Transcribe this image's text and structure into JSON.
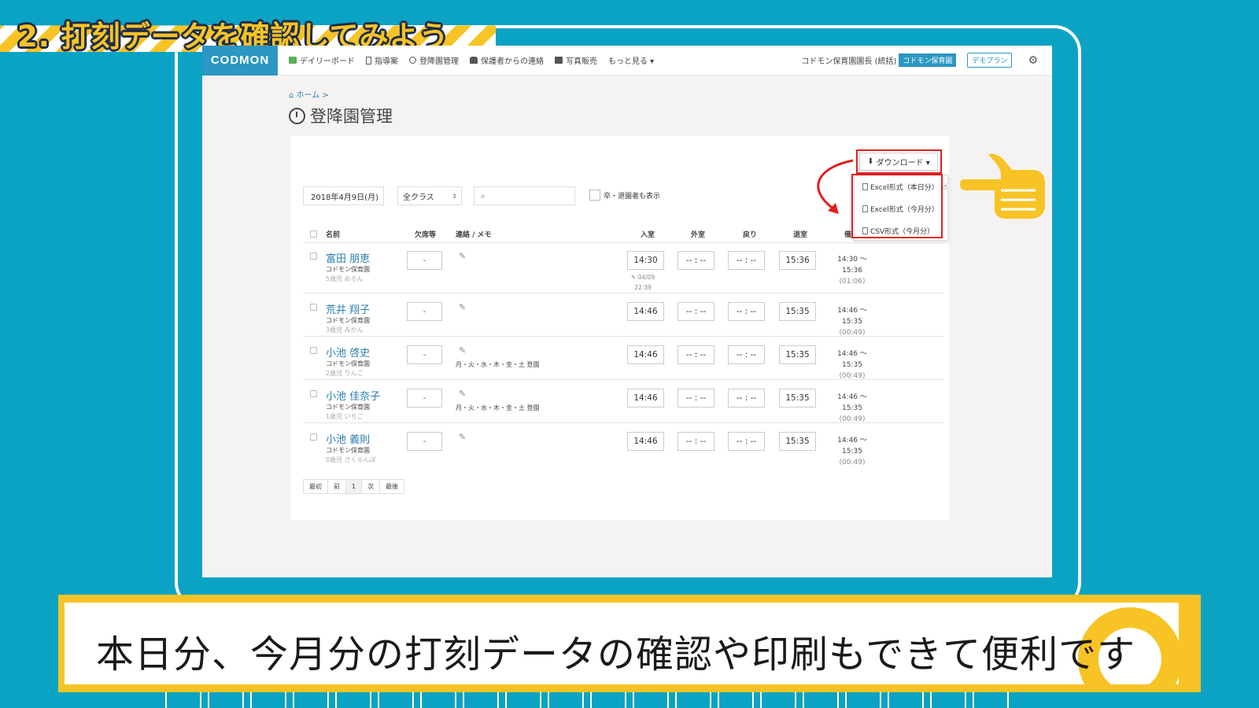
{
  "banner": {
    "title": "2. 打刻データを確認してみよう"
  },
  "nav": {
    "logo": "CODMON",
    "items": [
      "デイリーボード",
      "指導案",
      "登降園管理",
      "保護者からの連絡",
      "写真販売",
      "もっと見る ▾"
    ],
    "user": "コドモン保育園園長 (統括)",
    "org_badge": "コドモン保育園",
    "demo_plan": "デモプラン"
  },
  "page": {
    "breadcrumb": "ホーム >",
    "title": "登降園管理"
  },
  "toolbar": {
    "download_label": "ダウンロード ▾",
    "download_options": [
      "Excel形式（本日分）",
      "Excel形式（今月分）",
      "CSV形式（今月分）"
    ],
    "date": "2018年4月9日(月)",
    "class_select": "全クラス",
    "show_graduates": "卒・退園者も表示"
  },
  "table": {
    "headers": {
      "name": "名前",
      "absence": "欠席等",
      "memo": "連絡 / メモ",
      "in": "入室",
      "out": "外室",
      "back": "戻り",
      "leave": "退室",
      "note": "備"
    },
    "rows": [
      {
        "name": "富田 朋恵",
        "org": "コドモン保育園",
        "cls": "5歳児 めろん",
        "absence": "-",
        "memo": "",
        "in": "14:30",
        "out": "-- : --",
        "back": "-- : --",
        "leave": "15:36",
        "edit_date": "04/09",
        "edit_time": "22:39",
        "dur_from": "14:30 〜",
        "dur_to": "15:36",
        "dur": "(01:06)"
      },
      {
        "name": "荒井 翔子",
        "org": "コドモン保育園",
        "cls": "3歳児 みかん",
        "absence": "-",
        "memo": "",
        "in": "14:46",
        "out": "-- : --",
        "back": "-- : --",
        "leave": "15:35",
        "dur_from": "14:46 〜",
        "dur_to": "15:35",
        "dur": "(00:49)"
      },
      {
        "name": "小池 啓史",
        "org": "コドモン保育園",
        "cls": "2歳児 りんご",
        "absence": "-",
        "memo": "月・火・水・木・金・土 登園",
        "in": "14:46",
        "out": "-- : --",
        "back": "-- : --",
        "leave": "15:35",
        "dur_from": "14:46 〜",
        "dur_to": "15:35",
        "dur": "(00:49)"
      },
      {
        "name": "小池 佳奈子",
        "org": "コドモン保育園",
        "cls": "1歳児 いちご",
        "absence": "-",
        "memo": "月・火・水・木・金・土 登園",
        "in": "14:46",
        "out": "-- : --",
        "back": "-- : --",
        "leave": "15:35",
        "dur_from": "14:46 〜",
        "dur_to": "15:35",
        "dur": "(00:49)"
      },
      {
        "name": "小池 義則",
        "org": "コドモン保育園",
        "cls": "0歳児 さくらんぼ",
        "absence": "-",
        "memo": "",
        "in": "14:46",
        "out": "-- : --",
        "back": "-- : --",
        "leave": "15:35",
        "dur_from": "14:46 〜",
        "dur_to": "15:35",
        "dur": "(00:49)"
      }
    ]
  },
  "pagination": [
    "最初",
    "前",
    "1",
    "次",
    "最後"
  ],
  "subtitle": "本日分、今月分の打刻データの確認や印刷もできて便利です",
  "colors": {
    "accent_yellow": "#f7c325",
    "background": "#0ba3c4",
    "brand_blue": "#2b97c2",
    "highlight_red": "#e02020"
  }
}
